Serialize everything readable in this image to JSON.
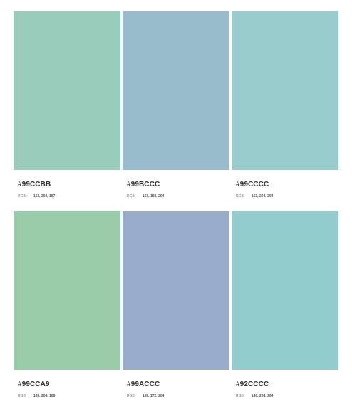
{
  "palette": [
    {
      "hex": "#99CCBB",
      "rgb_label": "RGB",
      "rgb_value": "153, 204, 187",
      "color": "#99CCBB"
    },
    {
      "hex": "#99BCCC",
      "rgb_label": "RGB",
      "rgb_value": "153, 188, 204",
      "color": "#99BCCC"
    },
    {
      "hex": "#99CCCC",
      "rgb_label": "RGB",
      "rgb_value": "153, 204, 204",
      "color": "#99CCCC"
    },
    {
      "hex": "#99CCA9",
      "rgb_label": "RGB",
      "rgb_value": "153, 204, 169",
      "color": "#99CCA9"
    },
    {
      "hex": "#99ACCC",
      "rgb_label": "RGB",
      "rgb_value": "153, 172, 204",
      "color": "#99ACCC"
    },
    {
      "hex": "#92CCCC",
      "rgb_label": "RGB",
      "rgb_value": "146, 204, 204",
      "color": "#92CCCC"
    }
  ]
}
